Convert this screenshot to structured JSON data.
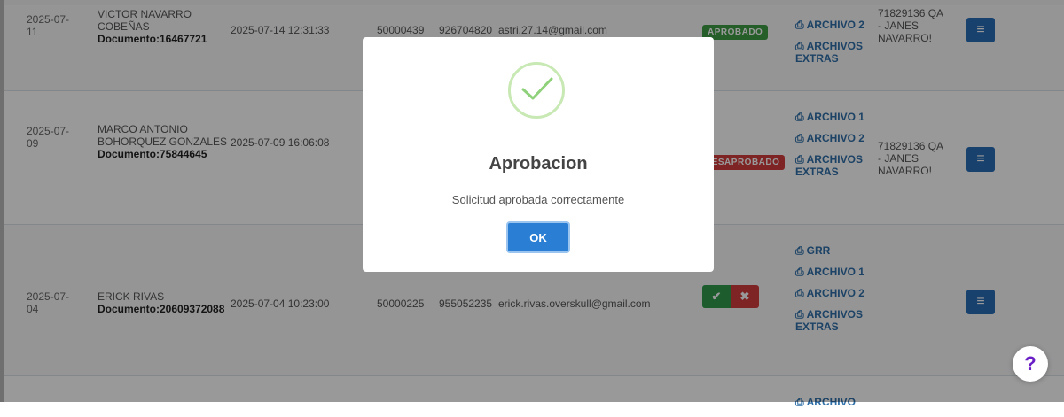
{
  "colors": {
    "approved": "#3f9d45",
    "rejected": "#d33d3d",
    "link": "#2f6fa8",
    "button": "#2a6db6",
    "help": "#6a1fc6"
  },
  "rows": [
    {
      "date": "2025-07-11",
      "name": "VICTOR NAVARRO COBEÑAS",
      "document": "Documento:16467721",
      "timestamp": "2025-07-14 12:31:33",
      "code": "50000439",
      "phone": "926704820",
      "email": "astri.27.14@gmail.com",
      "status": "APROBADO",
      "files": [
        "ARCHIVO 2",
        "ARCHIVOS EXTRAS"
      ],
      "assignee": "71829136 QA - JANES NAVARRO!"
    },
    {
      "date": "2025-07-09",
      "name": "MARCO ANTONIO BOHORQUEZ GONZALES",
      "document": "Documento:75844645",
      "timestamp": "2025-07-09 16:06:08",
      "status": "DESAPROBADO",
      "files": [
        "ARCHIVO 1",
        "ARCHIVO 2",
        "ARCHIVOS EXTRAS"
      ],
      "assignee": "71829136 QA - JANES NAVARRO!"
    },
    {
      "date": "2025-07-04",
      "name": "ERICK RIVAS",
      "document": "Documento:20609372088",
      "timestamp": "2025-07-04 10:23:00",
      "code": "50000225",
      "phone": "955052235",
      "email": "erick.rivas.overskull@gmail.com",
      "files": [
        "GRR",
        "ARCHIVO 1",
        "ARCHIVO 2",
        "ARCHIVOS EXTRAS"
      ]
    },
    {
      "files": [
        "ARCHIVO"
      ]
    }
  ],
  "modal": {
    "title": "Aprobacion",
    "message": "Solicitud aprobada correctamente",
    "ok_label": "OK"
  },
  "help_label": "?"
}
